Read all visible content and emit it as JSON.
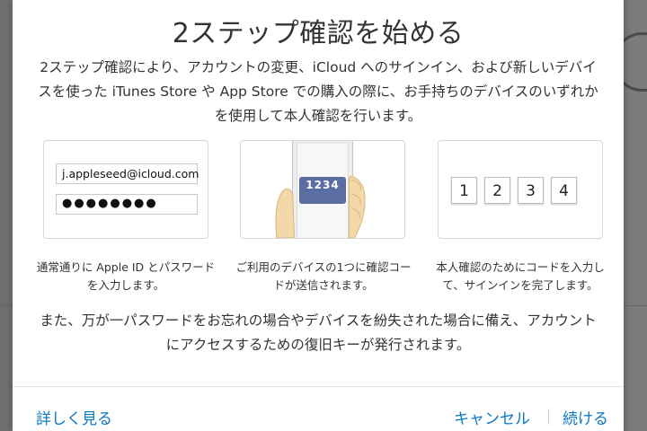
{
  "dialog": {
    "title": "2ステップ確認を始める",
    "intro": "2ステップ確認により、アカウントの変更、iCloud へのサインイン、および新しいデバイスを使った iTunes Store や App Store での購入の際に、お手持ちのデバイスのいずれかを使用して本人確認を行います。",
    "steps": [
      {
        "email_value": "j.appleseed@icloud.com",
        "password_value": "●●●●●●●●",
        "caption": "通常通りに Apple ID とパスワードを入力します。"
      },
      {
        "code": "1234",
        "caption": "ご利用のデバイスの1つに確認コードが送信されます。"
      },
      {
        "digits": [
          "1",
          "2",
          "3",
          "4"
        ],
        "caption": "本人確認のためにコードを入力して、サインインを完了します。"
      }
    ],
    "note": "また、万が一パスワードをお忘れの場合やデバイスを紛失された場合に備え、アカウントにアクセスするための復旧キーが発行されます。",
    "footer": {
      "learn_more": "詳しく見る",
      "cancel": "キャンセル",
      "continue": "続ける"
    }
  },
  "colors": {
    "link": "#0a78c2",
    "code_badge": "#5b6ea3",
    "overlay": "#7b7b7b"
  }
}
